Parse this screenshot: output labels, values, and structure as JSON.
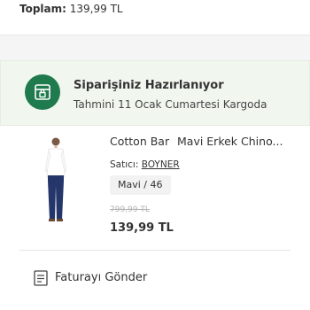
{
  "order": {
    "total_label": "Toplam:",
    "total_value": "139,99 TL"
  },
  "status": {
    "icon": "package-lock-icon",
    "title": "Siparişiniz Hazırlanıyor",
    "delivery_estimate": "Tahmini 11 Ocak Cumartesi Kargoda",
    "color": "#1f7a4d"
  },
  "product": {
    "brand": "Cotton Bar",
    "name": "Mavi Erkek Chino...",
    "seller_label": "Satıcı:",
    "seller_name": "BOYNER",
    "variant": "Mavi / 46",
    "old_price": "799,99 TL",
    "price": "139,99 TL"
  },
  "actions": {
    "invoice_label": "Faturayı Gönder",
    "invoice_icon": "invoice-icon"
  }
}
